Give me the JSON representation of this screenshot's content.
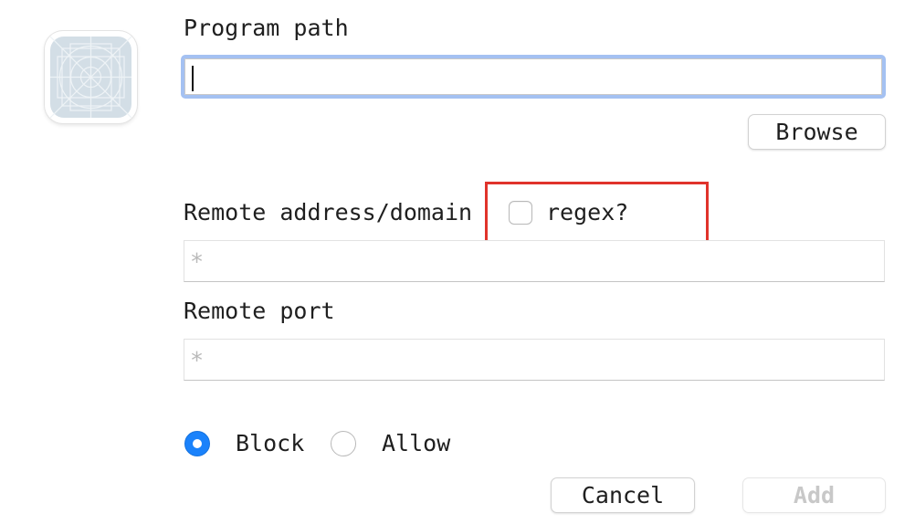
{
  "icon": "app-placeholder-icon",
  "program": {
    "label": "Program path",
    "value": "",
    "browse_label": "Browse"
  },
  "remote": {
    "address_label": "Remote address/domain",
    "regex_label": "regex?",
    "regex_checked": false,
    "address_placeholder": "*",
    "port_label": "Remote port",
    "port_placeholder": "*"
  },
  "action": {
    "block_label": "Block",
    "allow_label": "Allow",
    "selected": "Block"
  },
  "footer": {
    "cancel_label": "Cancel",
    "add_label": "Add",
    "add_enabled": false
  },
  "colors": {
    "focus_ring": "#a4c1f2",
    "radio_selected": "#1a82fb",
    "highlight": "#e0332b"
  }
}
